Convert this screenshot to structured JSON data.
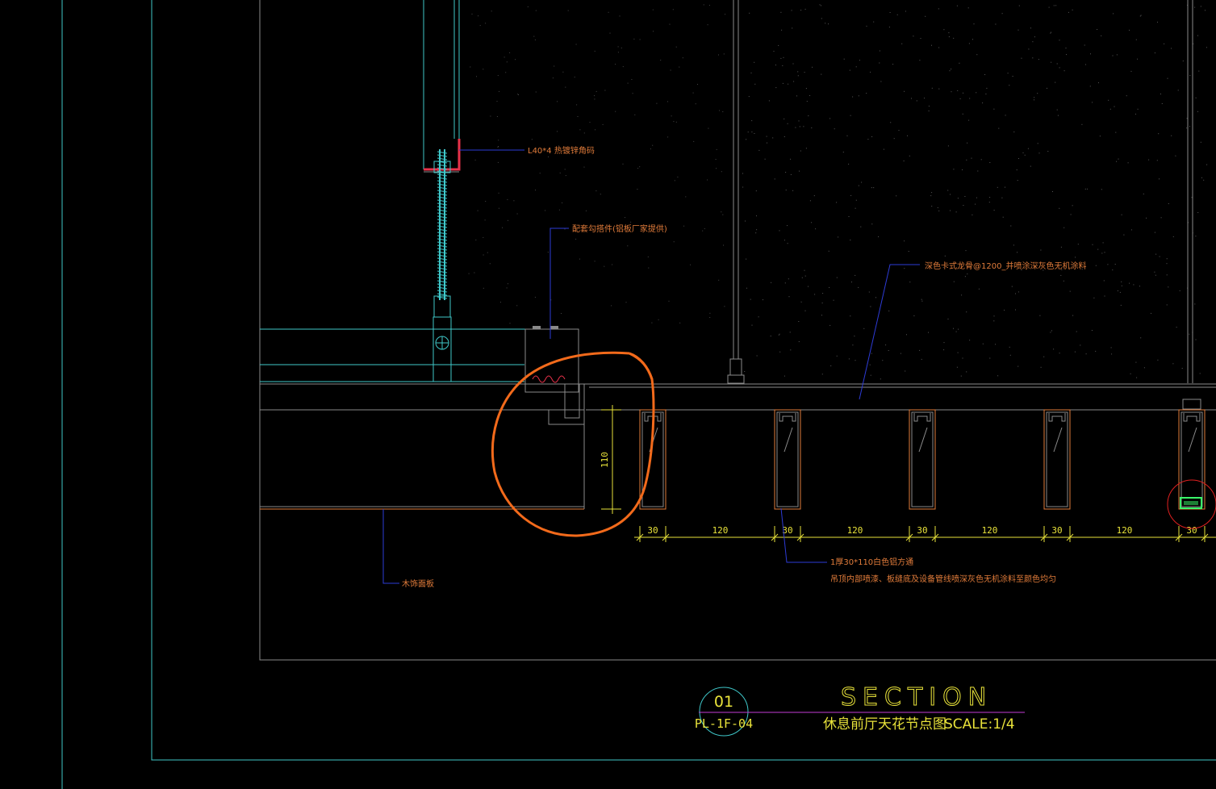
{
  "colors": {
    "background": "#000000",
    "frame_cyan": "#3fc7c9",
    "grid_gray": "#8a8a8a",
    "annotation_orange": "#e07b3a",
    "leader_blue": "#2d3bd6",
    "dimension_yellow": "#e8e23a",
    "markup_orange": "#f26a1b",
    "markup_red": "#e02020",
    "title_magenta": "#c23bd6",
    "steel_red": "#e8324a"
  },
  "annotations": {
    "angle_bracket": "L40*4 热镀锌角码",
    "clip": "配套勾搭件(铝板厂家提供)",
    "keel": "深色卡式龙骨@1200_并喷涂深灰色无机涂料",
    "wood_base": "木饰面板",
    "aluminum_tube": "1厚30*110白色铝方通",
    "paint_note": "吊顶内部喷漆、板缝底及设备管线喷深灰色无机涂料至颜色均匀"
  },
  "dimensions": {
    "height": "110",
    "spacing": [
      "30",
      "120",
      "30",
      "120",
      "30",
      "120",
      "30",
      "120",
      "30"
    ]
  },
  "title_block": {
    "section_number": "01",
    "sheet_ref": "PL-1F-04",
    "heading": "SECTION",
    "drawing_name": "休息前厅天花节点图",
    "scale": "SCALE:1/4"
  },
  "markup": {
    "tool": "freehand-circle",
    "zoom_marker": "red-circle"
  }
}
